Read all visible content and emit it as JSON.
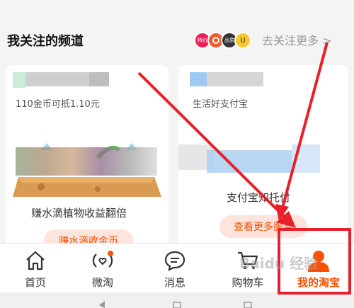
{
  "header": {
    "title": "我关注的频道",
    "follow_more": "去关注更多 >",
    "badges": [
      "特价",
      "",
      "品质",
      "U"
    ]
  },
  "cards": {
    "left": {
      "subtitle": "110金币可抵1.10元",
      "caption": "赚水滴植物收益翻倍",
      "button": "赚水滴收金币"
    },
    "right": {
      "subtitle": "生活好支付宝",
      "caption": "支付宝知托付",
      "button": "查看更多服务"
    }
  },
  "tabs": [
    {
      "label": "首页"
    },
    {
      "label": "微淘"
    },
    {
      "label": "消息"
    },
    {
      "label": "购物车"
    },
    {
      "label": "我的淘宝"
    }
  ],
  "watermark": "Baidu 经验",
  "colors": {
    "accent": "#ff5000",
    "annotation": "#e8202a"
  }
}
